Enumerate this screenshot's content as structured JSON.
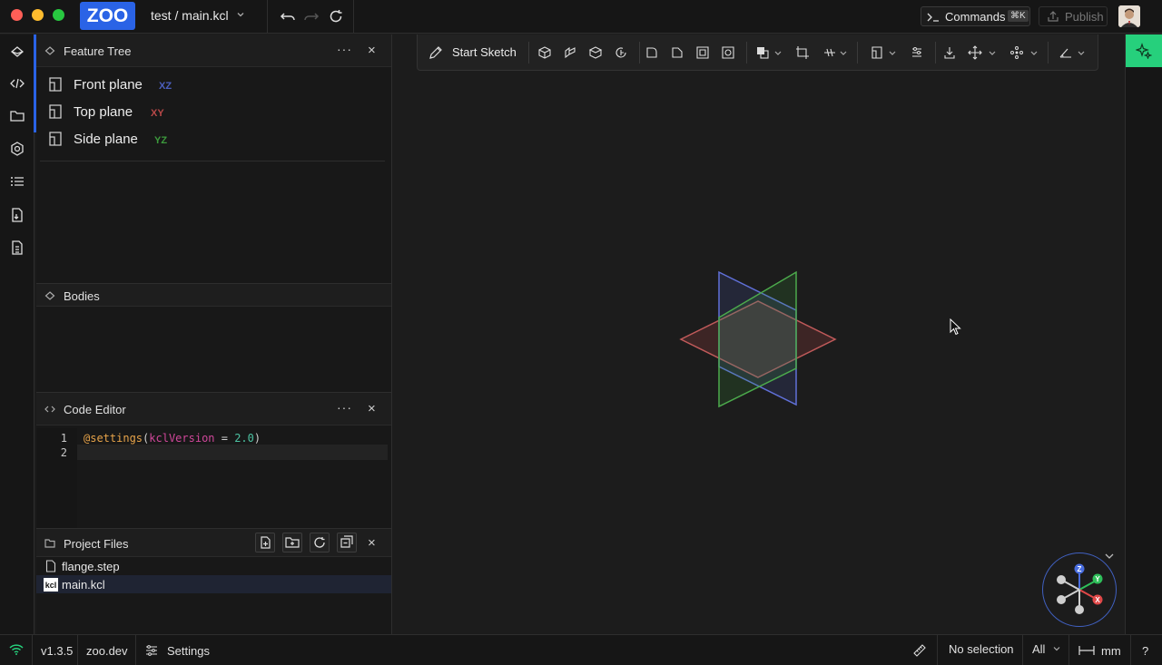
{
  "window": {
    "logo_text": "ZOO",
    "project_title": "test / main.kcl",
    "commands_label": "Commands",
    "commands_shortcut": "⌘K",
    "publish_label": "Publish"
  },
  "feature_tree": {
    "title": "Feature Tree",
    "more": "···",
    "close": "×",
    "planes": [
      {
        "name": "Front plane",
        "axis": "XZ",
        "color": "#4c5fbf"
      },
      {
        "name": "Top plane",
        "axis": "XY",
        "color": "#b84848"
      },
      {
        "name": "Side plane",
        "axis": "YZ",
        "color": "#3c9a3c"
      }
    ]
  },
  "bodies": {
    "title": "Bodies"
  },
  "code_editor": {
    "title": "Code Editor",
    "more": "···",
    "close": "×",
    "line_numbers": [
      "1",
      "2"
    ],
    "line1": {
      "decorator": "@settings",
      "open_paren": "(",
      "param": "kclVersion",
      "equals": " = ",
      "value": "2.0",
      "close_paren": ")"
    }
  },
  "project_files": {
    "title": "Project Files",
    "close": "×",
    "files": [
      {
        "name": "flange.step",
        "icon": "file-icon"
      },
      {
        "name": "main.kcl",
        "icon": "kcl-file-icon",
        "icon_text": "kcl"
      }
    ]
  },
  "toolbar": {
    "start_sketch_label": "Start Sketch"
  },
  "gizmo": {
    "axes": [
      {
        "label": "Z",
        "color": "#4a6ee0"
      },
      {
        "label": "Y",
        "color": "#2fbf5a"
      },
      {
        "label": "X",
        "color": "#e04848"
      }
    ]
  },
  "statusbar": {
    "version": "v1.3.5",
    "site": "zoo.dev",
    "settings_label": "Settings",
    "selection": "No selection",
    "filter": "All",
    "units": "mm",
    "help": "?"
  },
  "colors": {
    "accent": "#2a63e6",
    "ai": "#26d07c"
  }
}
